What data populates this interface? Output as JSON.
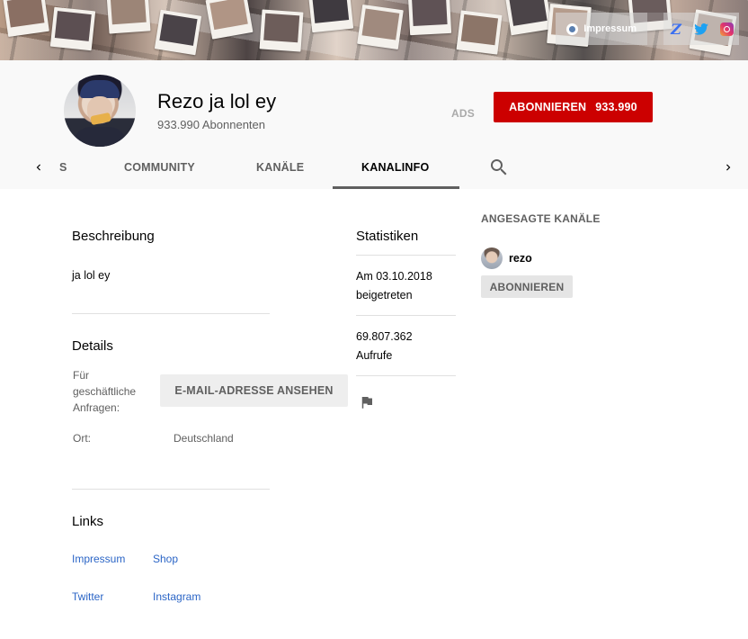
{
  "banner": {
    "impressum_label": "Impressum",
    "social_icons": [
      "z-icon",
      "twitter-icon",
      "instagram-icon"
    ]
  },
  "channel": {
    "name": "Rezo ja lol ey",
    "subscribers_text": "933.990 Abonnenten",
    "ads_label": "ADS",
    "subscribe_label": "ABONNIEREN",
    "subscribe_count": "933.990",
    "brand_color": "#cc0000"
  },
  "tabs": {
    "items": [
      {
        "label": "S",
        "active": false
      },
      {
        "label": "COMMUNITY",
        "active": false
      },
      {
        "label": "KANÄLE",
        "active": false
      },
      {
        "label": "KANALINFO",
        "active": true
      }
    ]
  },
  "about": {
    "description_heading": "Beschreibung",
    "description_text": "ja lol ey",
    "details_heading": "Details",
    "business_label": "Für geschäftliche Anfragen:",
    "email_button_label": "E-MAIL-ADRESSE ANSEHEN",
    "location_label": "Ort:",
    "location_value": "Deutschland",
    "links_heading": "Links",
    "links": [
      {
        "label": "Impressum"
      },
      {
        "label": "Shop"
      },
      {
        "label": "Twitter"
      },
      {
        "label": "Instagram"
      }
    ]
  },
  "stats": {
    "heading": "Statistiken",
    "joined_line1": "Am 03.10.2018",
    "joined_line2": "beigetreten",
    "views_line1": "69.807.362",
    "views_line2": "Aufrufe"
  },
  "featured": {
    "heading": "ANGESAGTE KANÄLE",
    "channel_name": "rezo",
    "subscribe_label": "ABONNIEREN"
  }
}
